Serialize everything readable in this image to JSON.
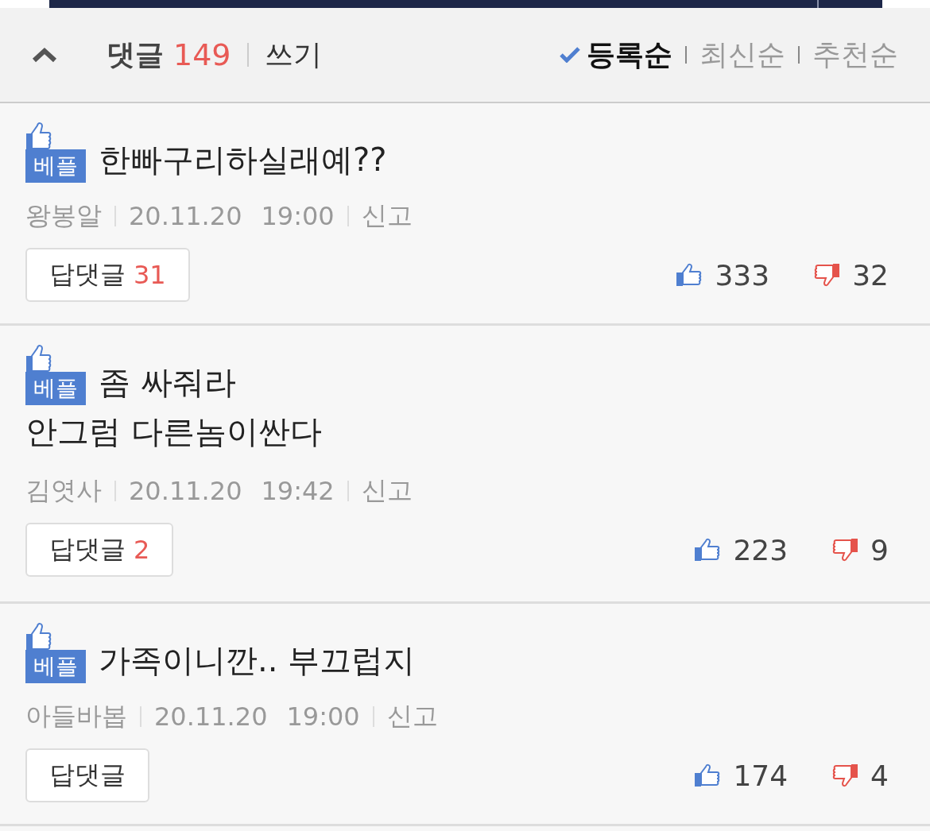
{
  "header": {
    "title": "댓글",
    "count": "149",
    "write": "쓰기",
    "sort": [
      {
        "label": "등록순",
        "selected": true
      },
      {
        "label": "최신순",
        "selected": false
      },
      {
        "label": "추천순",
        "selected": false
      }
    ]
  },
  "comments": [
    {
      "best": true,
      "badge": "베플",
      "lines": [
        "한빠구리하실래예??"
      ],
      "author": "왕봉알",
      "date": "20.11.20",
      "time": "19:00",
      "report": "신고",
      "reply_label": "답댓글",
      "reply_count": "31",
      "likes": "333",
      "dislikes": "32"
    },
    {
      "best": true,
      "badge": "베플",
      "lines": [
        "좀 싸줘라",
        "안그럼 다른놈이싼다"
      ],
      "author": "김엿사",
      "date": "20.11.20",
      "time": "19:42",
      "report": "신고",
      "reply_label": "답댓글",
      "reply_count": "2",
      "likes": "223",
      "dislikes": "9"
    },
    {
      "best": true,
      "badge": "베플",
      "lines": [
        "가족이니깐.. 부끄럽지"
      ],
      "author": "아들바봅",
      "date": "20.11.20",
      "time": "19:00",
      "report": "신고",
      "reply_label": "답댓글",
      "likes": "174",
      "dislikes": "4"
    }
  ]
}
